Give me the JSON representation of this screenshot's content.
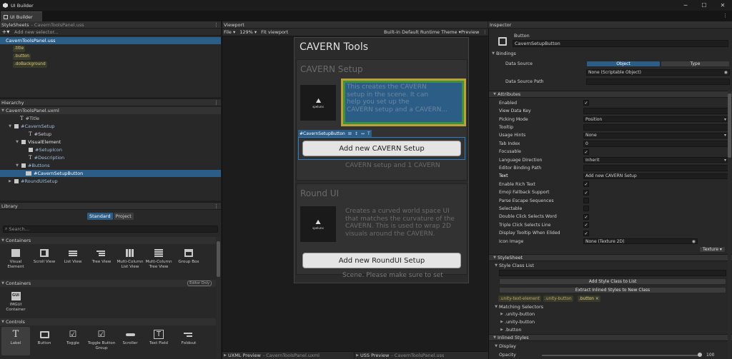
{
  "window": {
    "title": "UI Builder",
    "minimize": "─",
    "maximize": "☐",
    "close": "✕"
  },
  "tab": {
    "label": "UI Builder"
  },
  "stylesheets": {
    "title": "StyleSheets",
    "subtitle": "- CavernToolsPanel.uss",
    "add_placeholder": "Add new selector...",
    "file": "CavernToolsPanel.uss",
    "selectors": [
      ".title",
      ".button",
      ".doBackground"
    ]
  },
  "hierarchy": {
    "title": "Hierarchy",
    "items": [
      {
        "label": "CavernToolsPanel.uxml"
      },
      {
        "label": "#Title"
      },
      {
        "label": "#CavernSetup"
      },
      {
        "label": "#Setup"
      },
      {
        "label": "VisualElement"
      },
      {
        "label": "#SetupIcon"
      },
      {
        "label": "#Description"
      },
      {
        "label": "#Buttons"
      },
      {
        "label": "#CavernSetupButton"
      },
      {
        "label": "#RoundUISetup"
      }
    ]
  },
  "library": {
    "title": "Library",
    "tab_standard": "Standard",
    "tab_project": "Project",
    "search_placeholder": "Search...",
    "sec_containers": "Containers",
    "sec_containers2": "Containers",
    "editor_only": "Editor Only",
    "sec_controls": "Controls",
    "containers": [
      "Visual Element",
      "Scroll View",
      "List View",
      "Tree View",
      "Multi-Column List View",
      "Multi-Column Tree View",
      "Group Box"
    ],
    "imgui": "IMGUI Container",
    "controls": [
      "Label",
      "Button",
      "Toggle",
      "Toggle Button Group",
      "Scroller",
      "Text Field",
      "Foldout"
    ]
  },
  "viewport": {
    "title": "Viewport",
    "file_menu": "File",
    "zoom": "129%",
    "fit": "Fit viewport",
    "theme": "Built-in Default Runtime Theme",
    "preview": "Preview",
    "panel_title": "CAVERN Tools",
    "card1_title": "CAVERN Setup",
    "card1_lines": [
      "This creates the CAVERN",
      "setup in the scene. It can",
      "help you set up the",
      "CAVERN setup and a CAVERN..."
    ],
    "card1_overflow": "CAVERN setup and 1 CAVERN",
    "logo_text": "spelunx",
    "selected_label": "#CavernSetupButton",
    "btn1": "Add new CAVERN Setup",
    "card2_title": "Round UI",
    "card2_lines": [
      "Creates a curved world space UI",
      "that matches the curvature of the",
      "CAVERN. This is used to wrap 2D",
      "visuals around the CAVERN."
    ],
    "btn2": "Add new RoundUI Setup",
    "overflow_text": "Scene. Please make sure to set",
    "uxml_preview": "UXML Preview",
    "uxml_file": "- CavernToolsPanel.uxml",
    "uss_preview": "USS Preview",
    "uss_file": "- CavernToolsPanel.uss"
  },
  "inspector": {
    "title": "Inspector",
    "element_type": "Button",
    "element_name": "CavernSetupButton",
    "bindings": "Bindings",
    "data_source": "Data Source",
    "object": "Object",
    "type": "Type",
    "none_scriptable": "None (Scriptable Object)",
    "data_source_path": "Data Source Path",
    "attributes": "Attributes",
    "rows": [
      {
        "label": "Enabled",
        "kind": "check",
        "value": "✓"
      },
      {
        "label": "View Data Key",
        "kind": "field",
        "value": ""
      },
      {
        "label": "Picking Mode",
        "kind": "drop",
        "value": "Position"
      },
      {
        "label": "Tooltip",
        "kind": "field",
        "value": ""
      },
      {
        "label": "Usage Hints",
        "kind": "drop",
        "value": "None"
      },
      {
        "label": "Tab Index",
        "kind": "field",
        "value": "0"
      },
      {
        "label": "Focusable",
        "kind": "check",
        "value": "✓"
      },
      {
        "label": "Language Direction",
        "kind": "drop",
        "value": "Inherit"
      },
      {
        "label": "Editor Binding Path",
        "kind": "field",
        "value": ""
      },
      {
        "label": "Text",
        "kind": "field",
        "value": "Add new CAVERN Setup"
      },
      {
        "label": "Enable Rich Text",
        "kind": "check",
        "value": "✓"
      },
      {
        "label": "Emoji Fallback Support",
        "kind": "check",
        "value": "✓"
      },
      {
        "label": "Parse Escape Sequences",
        "kind": "check",
        "value": ""
      },
      {
        "label": "Selectable",
        "kind": "check",
        "value": ""
      },
      {
        "label": "Double Click Selects Word",
        "kind": "check",
        "value": "✓"
      },
      {
        "label": "Triple Click Selects Line",
        "kind": "check",
        "value": "✓"
      },
      {
        "label": "Display Tooltip When Elided",
        "kind": "check",
        "value": "✓"
      },
      {
        "label": "Icon Image",
        "kind": "icon",
        "value": "None (Texture 2D)"
      }
    ],
    "texture_drop": "Texture",
    "stylesheet": "StyleSheet",
    "style_class_list": "Style Class List",
    "add_style_class": "Add Style Class to List",
    "extract_styles": "Extract Inlined Styles to New Class",
    "classes": [
      ".unity-text-element",
      ".unity-button",
      ".button"
    ],
    "remove_class": "×",
    "matching_selectors": "Matching Selectors",
    "matches": [
      ".unity-button",
      ".unity-button",
      ".button"
    ],
    "inlined_styles": "Inlined Styles",
    "display": "Display",
    "opacity": "Opacity",
    "opacity_value": "100",
    "colors": {
      "accent": "#2c5d87",
      "selection_green": "#3f8f3c",
      "selection_yellow": "#b9a23a"
    }
  }
}
